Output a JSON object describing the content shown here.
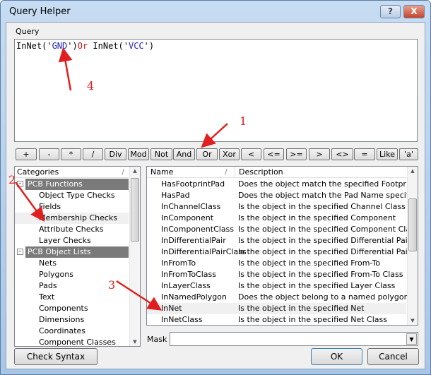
{
  "window": {
    "title": "Query Helper",
    "help": "?",
    "close": "X"
  },
  "query": {
    "label": "Query",
    "parts": [
      {
        "text": "InNet('",
        "cls": ""
      },
      {
        "text": "GND",
        "cls": "q-str"
      },
      {
        "text": "')",
        "cls": ""
      },
      {
        "text": "Or",
        "cls": "q-kw"
      },
      {
        "text": " InNet('",
        "cls": ""
      },
      {
        "text": "VCC",
        "cls": "q-str"
      },
      {
        "text": "')",
        "cls": ""
      }
    ]
  },
  "operators": [
    "+",
    "-",
    "*",
    "/",
    "Div",
    "Mod",
    "Not",
    "And",
    "Or",
    "Xor",
    "<",
    "<=",
    ">=",
    ">",
    "<>",
    "=",
    "Like",
    "'a'"
  ],
  "categories": {
    "header": "Categories",
    "groups": [
      {
        "label": "PCB Functions",
        "items": [
          "Object Type Checks",
          "Fields",
          "Membership Checks",
          "Attribute Checks",
          "Layer Checks"
        ]
      },
      {
        "label": "PCB Object Lists",
        "items": [
          "Nets",
          "Polygons",
          "Pads",
          "Text",
          "Components",
          "Dimensions",
          "Coordinates",
          "Component Classes"
        ]
      }
    ],
    "selected": "Membership Checks"
  },
  "functions": {
    "headers": {
      "name": "Name",
      "description": "Description"
    },
    "selected": "InNet",
    "rows": [
      {
        "name": "HasFootprintPad",
        "description": "Does the object match the specified Footprint & ..."
      },
      {
        "name": "HasPad",
        "description": "Does the object match the Pad Name specified"
      },
      {
        "name": "InChannelClass",
        "description": "Is the object in the specified Channel Class"
      },
      {
        "name": "InComponent",
        "description": "Is the object in the specified Component"
      },
      {
        "name": "InComponentClass",
        "description": "Is the object in the specified Component Class"
      },
      {
        "name": "InDifferentialPair",
        "description": "Is the object in the specified Differential Pair"
      },
      {
        "name": "InDifferentialPairClass",
        "description": "Is the object in the specified Differential Pair Class"
      },
      {
        "name": "InFromTo",
        "description": "Is the object in the specified From-To"
      },
      {
        "name": "InFromToClass",
        "description": "Is the object in the specified From-To Class"
      },
      {
        "name": "InLayerClass",
        "description": "Is the object in the specified Layer Class"
      },
      {
        "name": "InNamedPolygon",
        "description": "Does the object belong to a named polygon"
      },
      {
        "name": "InNet",
        "description": "Is the object in the specified Net"
      },
      {
        "name": "InNetClass",
        "description": "Is the object in the specified Net Class"
      }
    ]
  },
  "mask": {
    "label": "Mask",
    "value": ""
  },
  "buttons": {
    "check_syntax": "Check Syntax",
    "ok": "OK",
    "cancel": "Cancel"
  },
  "annotations": [
    "1",
    "2",
    "3",
    "4"
  ],
  "colors": {
    "annotation": "#e02020",
    "group_bg": "#7a7a7a"
  }
}
